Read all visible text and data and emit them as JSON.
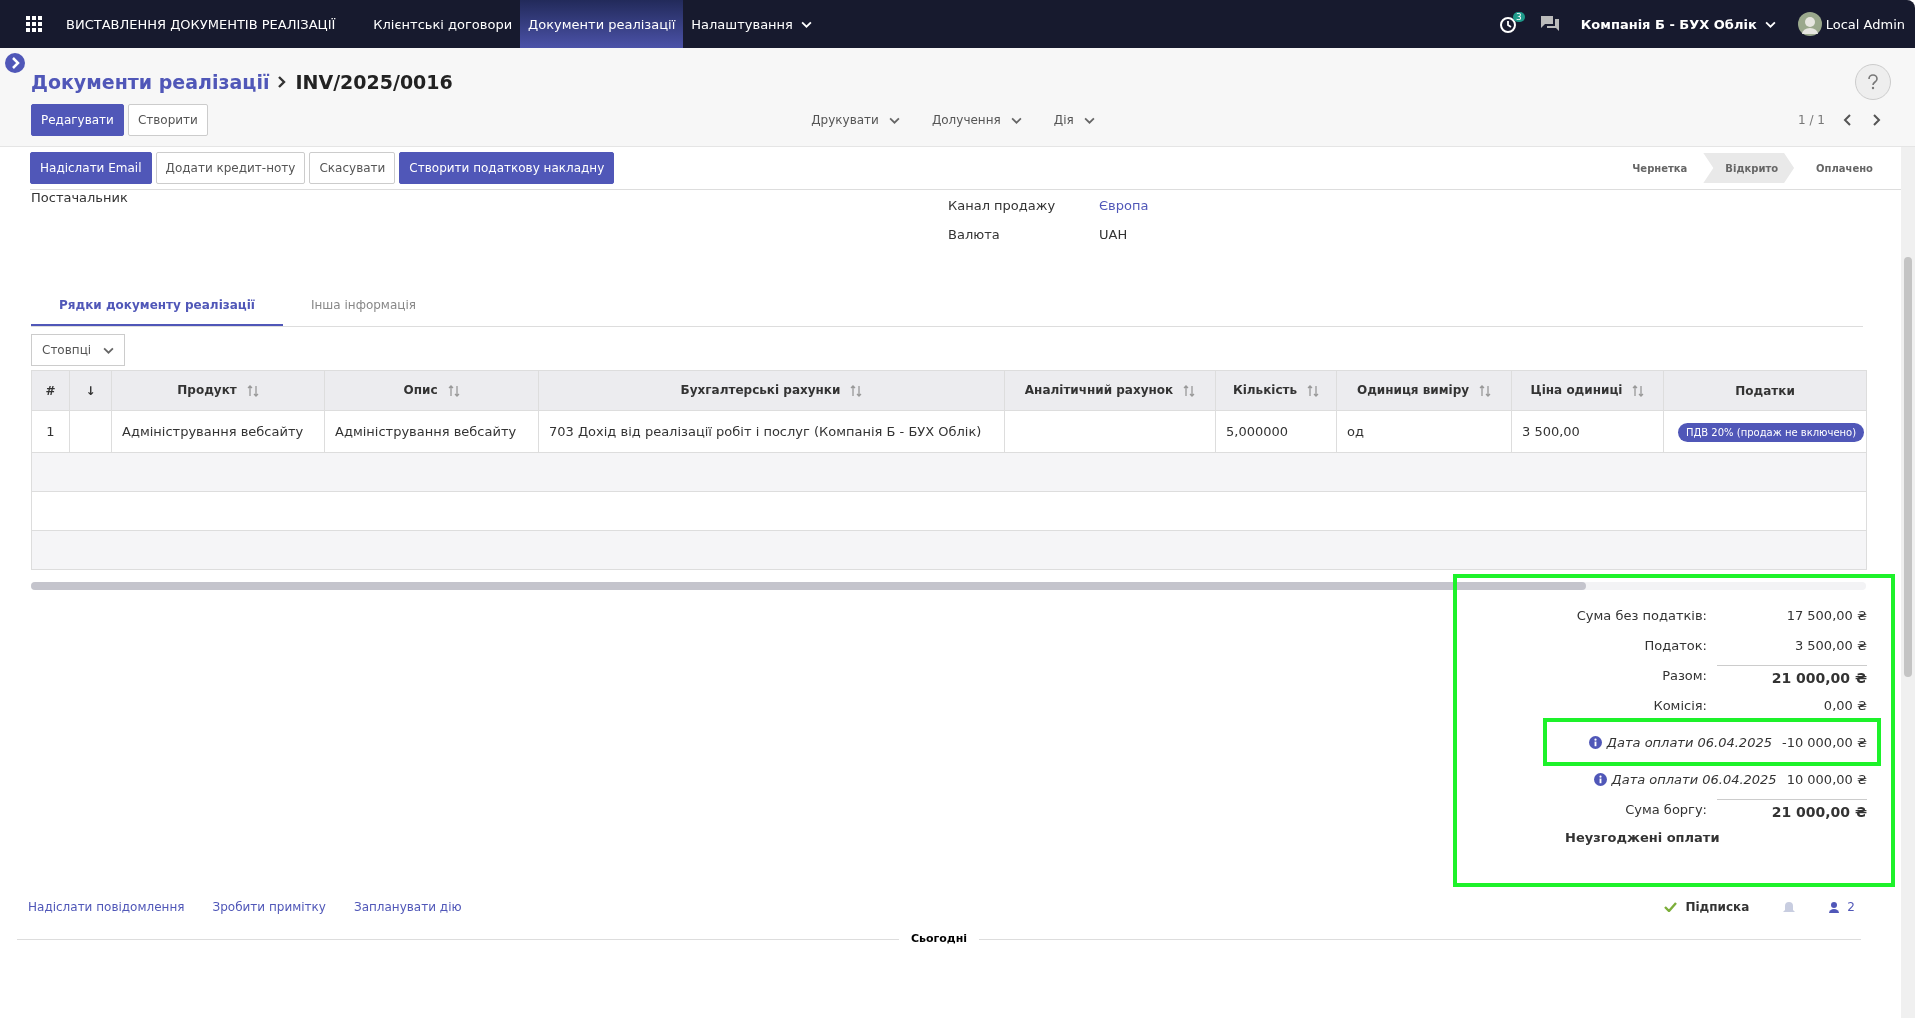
{
  "navbar": {
    "app_title": "ВИСТАВЛЕННЯ ДОКУМЕНТІВ РЕАЛІЗАЦІЇ",
    "menu": [
      {
        "label": "Клієнтські договори",
        "selected": false,
        "dropdown": false
      },
      {
        "label": "Документи реалізації",
        "selected": true,
        "dropdown": false
      },
      {
        "label": "Налаштування",
        "selected": false,
        "dropdown": true
      }
    ],
    "activity_count": "3",
    "company": "Компанія Б - БУХ Облік",
    "user": "Local Admin"
  },
  "breadcrumb": {
    "parent": "Документи реалізації",
    "current": "INV/2025/0016"
  },
  "control_buttons": [
    {
      "label": "Редагувати",
      "primary": true
    },
    {
      "label": "Створити",
      "primary": false
    }
  ],
  "dropdowns": [
    "Друкувати",
    "Долучення",
    "Дія"
  ],
  "pager": "1 / 1",
  "action_buttons": [
    {
      "label": "Надіслати Email",
      "primary": true
    },
    {
      "label": "Додати кредит-ноту",
      "primary": false
    },
    {
      "label": "Скасувати",
      "primary": false
    },
    {
      "label": "Створити податкову накладну",
      "primary": true
    }
  ],
  "statusbar": [
    {
      "label": "Чернетка",
      "selected": false
    },
    {
      "label": "Відкрито",
      "selected": true
    },
    {
      "label": "Оплачено",
      "selected": false
    }
  ],
  "form": {
    "left_label": "Постачальник",
    "fields": [
      {
        "label": "Канал продажу",
        "value": "Європа",
        "link": true
      },
      {
        "label": "Валюта",
        "value": "UAH",
        "link": false
      }
    ]
  },
  "tabs": [
    {
      "label": "Рядки документу реалізації",
      "selected": true
    },
    {
      "label": "Інша інформація",
      "selected": false
    }
  ],
  "columns_button": "Стовпці",
  "table": {
    "columns": [
      {
        "label": "#",
        "sortable": false
      },
      {
        "label": "↓",
        "sortable": false
      },
      {
        "label": "Продукт",
        "sortable": true
      },
      {
        "label": "Опис",
        "sortable": true
      },
      {
        "label": "Бухгалтерські рахунки",
        "sortable": true
      },
      {
        "label": "Аналітичний рахунок",
        "sortable": true
      },
      {
        "label": "Кількість",
        "sortable": true
      },
      {
        "label": "Одиниця виміру",
        "sortable": true
      },
      {
        "label": "Ціна одиниці",
        "sortable": true
      },
      {
        "label": "Податки",
        "sortable": false
      }
    ],
    "rows": [
      {
        "cells": [
          "1",
          "",
          "Адміністрування вебсайту",
          "Адміністрування вебсайту",
          "703 Дохід від реалізації робіт і послуг (Компанія Б - БУХ Облік)",
          "",
          "5,000000",
          "од",
          "3 500,00"
        ],
        "tax_tag": "ПДВ 20% (продаж не включено)"
      }
    ]
  },
  "totals": {
    "highlighted": true,
    "lines": [
      {
        "kind": "plain",
        "label": "Сума без податків:",
        "value": "17 500,00 ₴"
      },
      {
        "kind": "plain",
        "label": "Податок:",
        "value": "3 500,00 ₴"
      },
      {
        "kind": "total",
        "label": "Разом:",
        "value": "21 000,00 ₴"
      },
      {
        "kind": "plain",
        "label": "Комісія:",
        "value": "0,00 ₴"
      },
      {
        "kind": "payment",
        "label": "Дата оплати 06.04.2025",
        "value": "-10 000,00 ₴",
        "highlighted": true
      },
      {
        "kind": "payment",
        "label": "Дата оплати 06.04.2025",
        "value": "10 000,00 ₴",
        "highlighted": false
      },
      {
        "kind": "total",
        "label": "Сума боргу:",
        "value": "21 000,00 ₴"
      }
    ],
    "outstanding_title": "Неузгоджені оплати"
  },
  "chatter": {
    "links": [
      "Надіслати повідомлення",
      "Зробити примітку",
      "Запланувати дію"
    ],
    "follow": "Підписка",
    "followers": "2",
    "divider": "Сьогодні"
  }
}
